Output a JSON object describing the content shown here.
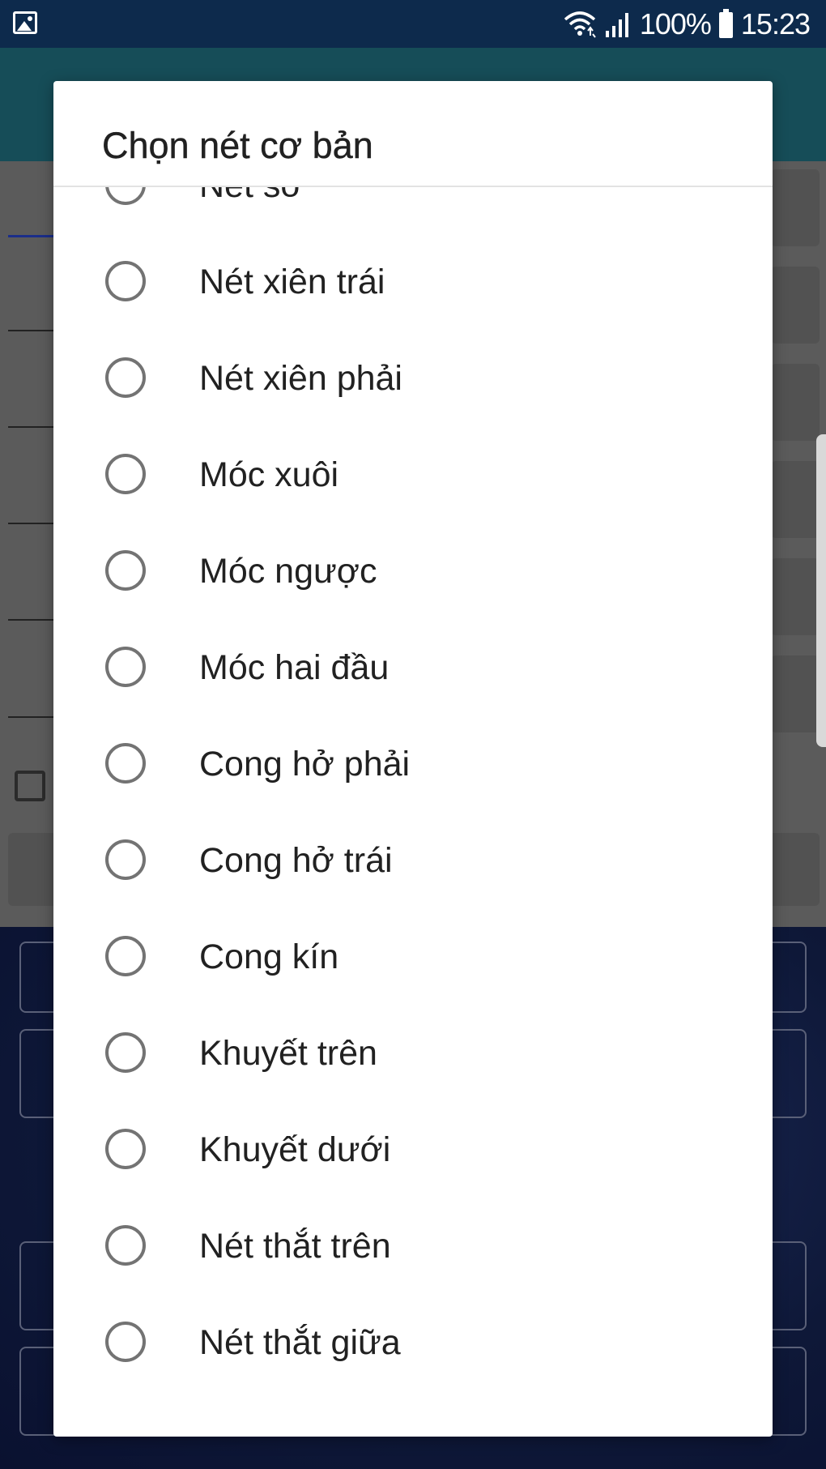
{
  "status_bar": {
    "battery_text": "100%",
    "time": "15:23",
    "icons": [
      "image-icon",
      "wifi-icon",
      "signal-icon",
      "battery-icon"
    ]
  },
  "dialog": {
    "title": "Chọn nét cơ bản",
    "options": [
      {
        "label": "Nét sổ",
        "selected": false
      },
      {
        "label": "Nét xiên trái",
        "selected": false
      },
      {
        "label": "Nét xiên phải",
        "selected": false
      },
      {
        "label": "Móc xuôi",
        "selected": false
      },
      {
        "label": "Móc ngược",
        "selected": false
      },
      {
        "label": "Móc hai đầu",
        "selected": false
      },
      {
        "label": "Cong hở phải",
        "selected": false
      },
      {
        "label": "Cong hở trái",
        "selected": false
      },
      {
        "label": "Cong kín",
        "selected": false
      },
      {
        "label": "Khuyết trên",
        "selected": false
      },
      {
        "label": "Khuyết dưới",
        "selected": false
      },
      {
        "label": "Nét thắt trên",
        "selected": false
      },
      {
        "label": "Nét thắt giữa",
        "selected": false
      }
    ]
  },
  "colors": {
    "status_bar_bg": "#0d2a4c",
    "app_header_bg": "#164d58",
    "dialog_bg": "#ffffff",
    "radio_border": "#737373",
    "text_primary": "#212121"
  }
}
